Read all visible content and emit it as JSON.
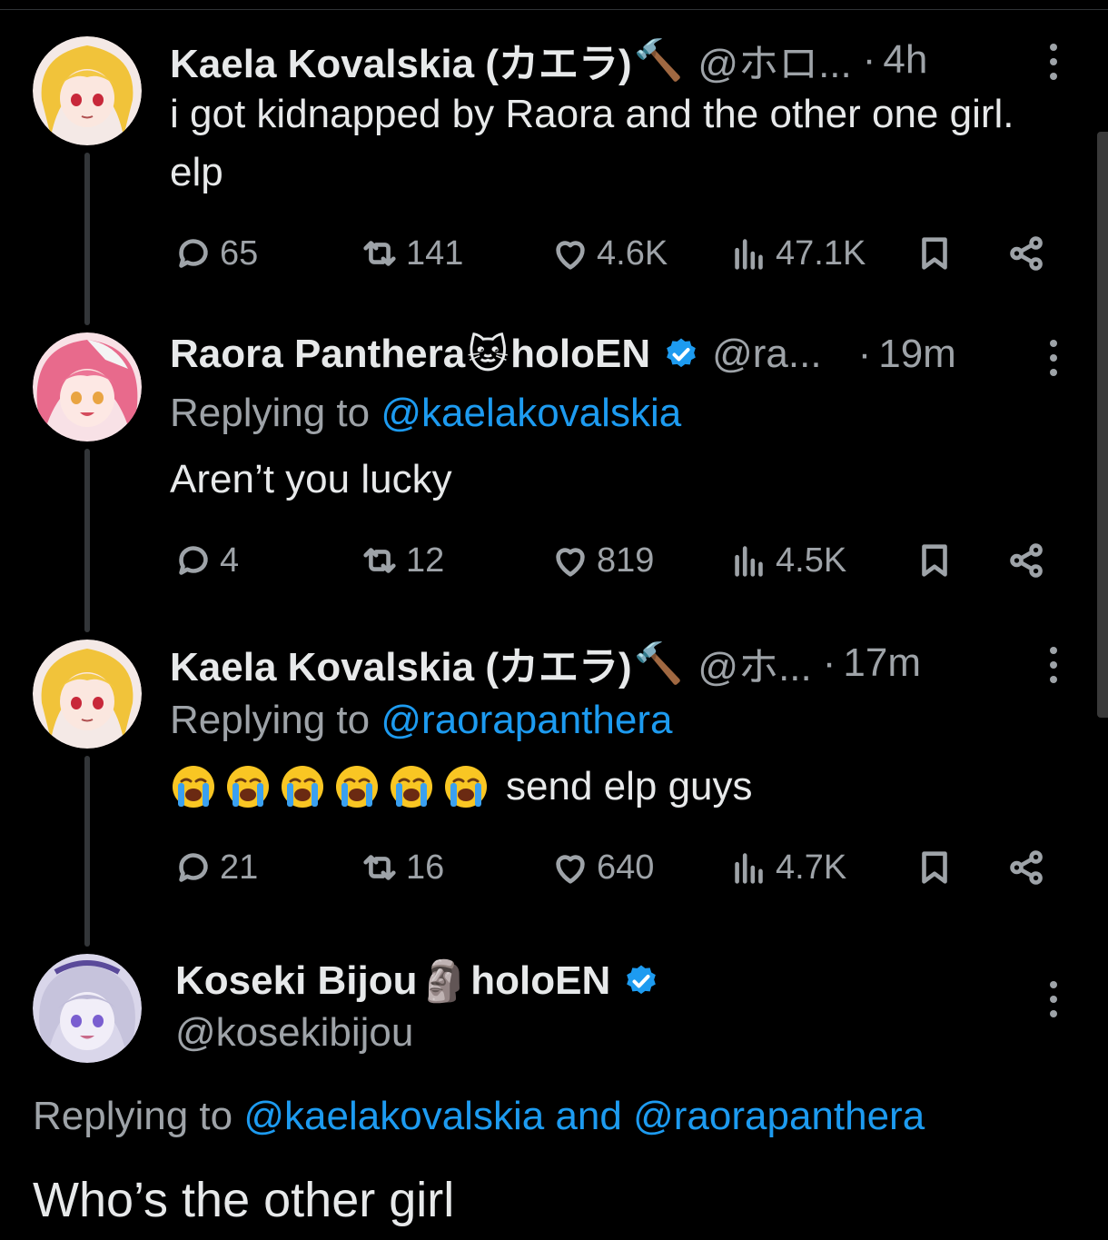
{
  "tweets": [
    {
      "name": "Kaela Kovalskia (カエラ)",
      "name_emoji": "🔨",
      "handle": "@ホロ...",
      "time": "4h",
      "text": "i got kidnapped by Raora and the other one girl. elp",
      "stats": {
        "replies": "65",
        "reposts": "141",
        "likes": "4.6K",
        "views": "47.1K"
      }
    },
    {
      "name": "Raora Panthera",
      "name_emoji": "🐱",
      "name_suffix": "holoEN",
      "handle": "@ra...",
      "time": "19m",
      "replying_label": "Replying to",
      "replying_to": "@kaelakovalskia",
      "text": "Aren’t you lucky",
      "stats": {
        "replies": "4",
        "reposts": "12",
        "likes": "819",
        "views": "4.5K"
      }
    },
    {
      "name": "Kaela Kovalskia (カエラ)",
      "name_emoji": "🔨",
      "handle": "@ホ...",
      "time": "17m",
      "replying_label": "Replying to",
      "replying_to": "@raorapanthera",
      "emoji_count": 6,
      "text": "send elp guys",
      "stats": {
        "replies": "21",
        "reposts": "16",
        "likes": "640",
        "views": "4.7K"
      }
    }
  ],
  "focused": {
    "name": "Koseki Bijou",
    "name_emoji": "🗿",
    "name_suffix": "holoEN",
    "handle": "@kosekibijou",
    "replying_label": "Replying to",
    "replying_to_1": "@kaelakovalskia",
    "replying_and": "and",
    "replying_to_2": "@raorapanthera",
    "text": "Who’s the other girl"
  },
  "colors": {
    "accent": "#1d9bf0",
    "muted": "#9ea3a8",
    "background": "#000000"
  },
  "icons": [
    "reply-icon",
    "repost-icon",
    "like-icon",
    "views-icon",
    "bookmark-icon",
    "share-icon",
    "more-icon",
    "verified-icon"
  ]
}
